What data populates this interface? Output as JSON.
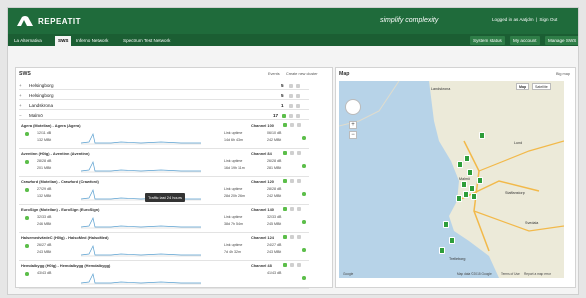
{
  "app": {
    "logo_text": "REPEATIT",
    "slogan": "simplify complexity",
    "user": {
      "logged_in_text": "Logged in as Aatjdm",
      "sep": "|",
      "signout": "Sign Out"
    }
  },
  "nav": {
    "tabs": [
      {
        "label": "La Alternativa"
      },
      {
        "label": "SWS",
        "active": true
      },
      {
        "label": "Inferno Network"
      },
      {
        "label": "Spectrum Test Network"
      }
    ],
    "right": [
      {
        "label": "System status"
      },
      {
        "label": "My account"
      },
      {
        "label": "Manage SWS"
      }
    ]
  },
  "sws_panel": {
    "title": "SWS",
    "links": [
      "Events",
      "Create new cluster"
    ],
    "sites": [
      {
        "name": "Helsingborg",
        "count": "5"
      },
      {
        "name": "Helsingborg",
        "count": "5"
      },
      {
        "name": "Landskrona",
        "count": "1"
      },
      {
        "name": "Malmö",
        "count": "17"
      }
    ],
    "devices": [
      {
        "header": "Agera (Motellan) - Agera (Agera)",
        "channel": "Channel 100",
        "signal": "12/11 dB",
        "rate": "132 MBit",
        "link_label": "Link uptime",
        "uptime": "14d 6h 43m",
        "rate_right": "06/10 dB",
        "mbit_right": "242 MBit"
      },
      {
        "header": "Aventinn (H0ig) - Aventinn (Aventinn)",
        "channel": "Channel 84",
        "signal": "28/28 dB",
        "rate": "201 MBit",
        "link_label": "Link uptime",
        "uptime": "16d 19h 11m",
        "rate_right": "26/28 dB",
        "mbit_right": "281 MBit"
      },
      {
        "header": "Crawford (Motellan) - Crawford (Crawford)",
        "channel": "Channel 120",
        "signal": "27/29 dB",
        "rate": "132 MBit",
        "link_label": "Link uptime",
        "uptime": "28d 20h 26m",
        "rate_right": "28/28 dB",
        "mbit_right": "242 MBit"
      },
      {
        "header": "EuroSign (Motellan) - EuroSign (EuroSign)",
        "channel": "Channel 140",
        "signal": "32/33 dB",
        "rate": "246 MBit",
        "link_label": "Link uptime",
        "uptime": "38d 7h 54m",
        "rate_right": "32/33 dB",
        "mbit_right": "245 MBit"
      },
      {
        "header": "HalsemedvärdeC (H0ig) - HalsoMed (HalsoMed)",
        "channel": "Channel 124",
        "signal": "26/27 dB",
        "rate": "243 MBit",
        "link_label": "Link uptime",
        "uptime": "7d 4h 32m",
        "rate_right": "24/27 dB",
        "mbit_right": "243 MBit"
      },
      {
        "header": "Hemdalbygg (H0ig) - Hemdalbygg (Hemdalbygg)",
        "channel": "Channel 48",
        "signal": "43/43 dB",
        "rate": "",
        "link_label": "",
        "uptime": "",
        "rate_right": "41/43 dB",
        "mbit_right": ""
      }
    ],
    "tooltip": "Traffic last 24 hours"
  },
  "map_panel": {
    "title": "Map",
    "link": "Big map",
    "types": [
      {
        "label": "Map",
        "selected": true
      },
      {
        "label": "Satellite"
      }
    ],
    "cities": [
      "Landskrona",
      "Lund",
      "Malmö",
      "Trelleborg",
      "Staffanstorp",
      "Svedala"
    ],
    "footer": [
      "Google",
      "Map data ©2015 Google",
      "Terms of Use",
      "Report a map error"
    ]
  },
  "colors": {
    "brand": "#1f6b3b",
    "nav": "#1b5e33",
    "ok": "#5cbe4a",
    "pin": "#2e9d3a"
  }
}
